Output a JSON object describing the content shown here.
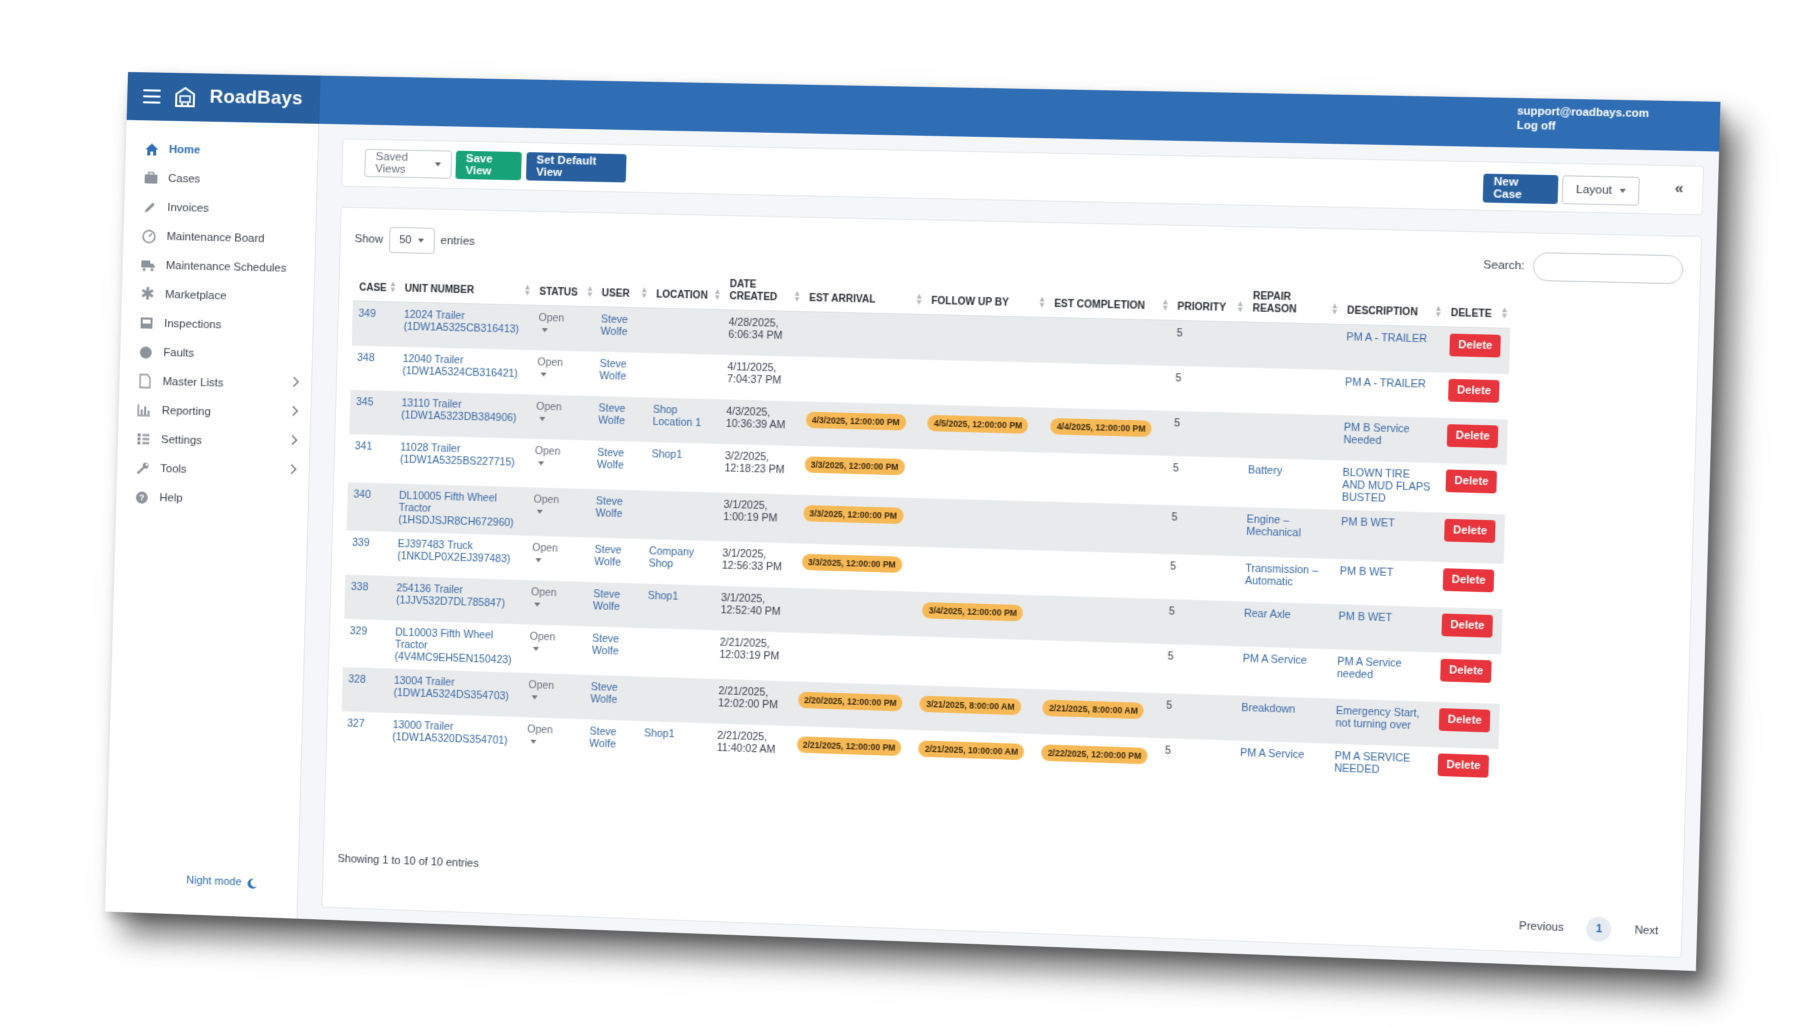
{
  "app": {
    "name": "RoadBays",
    "account_email": "support@roadbays.com",
    "logoff_label": "Log off",
    "colors": {
      "topbar": "#2f6db5",
      "save": "#17a277",
      "primary": "#275f9f",
      "delete": "#e8343d",
      "badge": "#f7b955"
    }
  },
  "sidebar": {
    "items": [
      {
        "label": "Home",
        "icon": "home-icon"
      },
      {
        "label": "Cases",
        "icon": "briefcase-icon"
      },
      {
        "label": "Invoices",
        "icon": "pencil-icon"
      },
      {
        "label": "Maintenance Board",
        "icon": "dashboard-icon"
      },
      {
        "label": "Maintenance Schedules",
        "icon": "truck-icon"
      },
      {
        "label": "Marketplace",
        "icon": "asterisk-icon"
      },
      {
        "label": "Inspections",
        "icon": "inbox-icon"
      },
      {
        "label": "Faults",
        "icon": "circle-icon"
      },
      {
        "label": "Master Lists",
        "icon": "file-icon"
      },
      {
        "label": "Reporting",
        "icon": "bar-chart-icon"
      },
      {
        "label": "Settings",
        "icon": "list-icon"
      },
      {
        "label": "Tools",
        "icon": "wrench-icon"
      },
      {
        "label": "Help",
        "icon": "question-icon"
      }
    ],
    "night_mode": "Night mode"
  },
  "toolbar": {
    "saved_views": "Saved Views",
    "save_view": "Save View",
    "set_default_view": "Set Default View",
    "new_case": "New Case",
    "layout": "Layout",
    "collapse": "«"
  },
  "list": {
    "show_label": "Show",
    "entries_value": "50",
    "entries_label": "entries",
    "search_label": "Search:",
    "columns": [
      "Case",
      "Unit Number",
      "Status",
      "User",
      "Location",
      "Date Created",
      "Est Arrival",
      "Follow Up By",
      "Est Completion",
      "Priority",
      "Repair Reason",
      "Description",
      "Delete"
    ],
    "rows": [
      {
        "case": "349",
        "unit": "12024 Trailer (1DW1A5325CB316413)",
        "status": "Open",
        "user": "Steve Wolfe",
        "location": "",
        "created": "4/28/2025, 6:06:34 PM",
        "arrival": "",
        "followup": "",
        "completion": "",
        "priority": "5",
        "reason": "",
        "description": "PM A - TRAILER",
        "delete": "Delete"
      },
      {
        "case": "348",
        "unit": "12040 Trailer (1DW1A5324CB316421)",
        "status": "Open",
        "user": "Steve Wolfe",
        "location": "",
        "created": "4/11/2025, 7:04:37 PM",
        "arrival": "",
        "followup": "",
        "completion": "",
        "priority": "5",
        "reason": "",
        "description": "PM A - TRAILER",
        "delete": "Delete"
      },
      {
        "case": "345",
        "unit": "13110 Trailer (1DW1A5323DB384906)",
        "status": "Open",
        "user": "Steve Wolfe",
        "location": "Shop Location 1",
        "created": "4/3/2025, 10:36:39 AM",
        "arrival": "4/3/2025, 12:00:00 PM",
        "followup": "4/5/2025, 12:00:00 PM",
        "completion": "4/4/2025, 12:00:00 PM",
        "priority": "5",
        "reason": "",
        "description": "PM B Service Needed",
        "delete": "Delete"
      },
      {
        "case": "341",
        "unit": "11028 Trailer (1DW1A5325BS227715)",
        "status": "Open",
        "user": "Steve Wolfe",
        "location": "Shop1",
        "created": "3/2/2025, 12:18:23 PM",
        "arrival": "3/3/2025, 12:00:00 PM",
        "followup": "",
        "completion": "",
        "priority": "5",
        "reason": "Battery",
        "description": "BLOWN TIRE AND MUD FLAPS BUSTED",
        "delete": "Delete"
      },
      {
        "case": "340",
        "unit": "DL10005 Fifth Wheel Tractor (1HSDJSJR8CH672960)",
        "status": "Open",
        "user": "Steve Wolfe",
        "location": "",
        "created": "3/1/2025, 1:00:19 PM",
        "arrival": "3/3/2025, 12:00:00 PM",
        "followup": "",
        "completion": "",
        "priority": "5",
        "reason": "Engine – Mechanical",
        "description": "PM B WET",
        "delete": "Delete"
      },
      {
        "case": "339",
        "unit": "EJ397483 Truck (1NKDLP0X2EJ397483)",
        "status": "Open",
        "user": "Steve Wolfe",
        "location": "Company Shop",
        "created": "3/1/2025, 12:56:33 PM",
        "arrival": "3/3/2025, 12:00:00 PM",
        "followup": "",
        "completion": "",
        "priority": "5",
        "reason": "Transmission – Automatic",
        "description": "PM B WET",
        "delete": "Delete"
      },
      {
        "case": "338",
        "unit": "254136 Trailer (1JJV532D7DL785847)",
        "status": "Open",
        "user": "Steve Wolfe",
        "location": "Shop1",
        "created": "3/1/2025, 12:52:40 PM",
        "arrival": "",
        "followup": "3/4/2025, 12:00:00 PM",
        "completion": "",
        "priority": "5",
        "reason": "Rear Axle",
        "description": "PM B WET",
        "delete": "Delete"
      },
      {
        "case": "329",
        "unit": "DL10003 Fifth Wheel Tractor (4V4MC9EH5EN150423)",
        "status": "Open",
        "user": "Steve Wolfe",
        "location": "",
        "created": "2/21/2025, 12:03:19 PM",
        "arrival": "",
        "followup": "",
        "completion": "",
        "priority": "5",
        "reason": "PM A Service",
        "description": "PM A Service needed",
        "delete": "Delete"
      },
      {
        "case": "328",
        "unit": "13004 Trailer (1DW1A5324DS354703)",
        "status": "Open",
        "user": "Steve Wolfe",
        "location": "",
        "created": "2/21/2025, 12:02:00 PM",
        "arrival": "2/20/2025, 12:00:00 PM",
        "followup": "3/21/2025, 8:00:00 AM",
        "completion": "2/21/2025, 8:00:00 AM",
        "priority": "5",
        "reason": "Breakdown",
        "description": "Emergency Start, not turning over",
        "delete": "Delete"
      },
      {
        "case": "327",
        "unit": "13000 Trailer (1DW1A5320DS354701)",
        "status": "Open",
        "user": "Steve Wolfe",
        "location": "Shop1",
        "created": "2/21/2025, 11:40:02 AM",
        "arrival": "2/21/2025, 12:00:00 PM",
        "followup": "2/21/2025, 10:00:00 AM",
        "completion": "2/22/2025, 12:00:00 PM",
        "priority": "5",
        "reason": "PM A Service",
        "description": "PM A SERVICE NEEDED",
        "delete": "Delete"
      }
    ],
    "info": "Showing 1 to 10 of 10 entries",
    "pagination": {
      "previous": "Previous",
      "page": "1",
      "next": "Next"
    }
  }
}
